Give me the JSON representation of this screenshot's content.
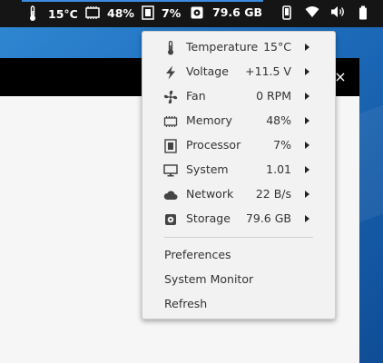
{
  "panel": {
    "temperature": "15°C",
    "memory": "48%",
    "processor": "7%",
    "storage": "79.6 GB"
  },
  "window": {
    "close_glyph": "×"
  },
  "menu": {
    "sensors": [
      {
        "label": "Temperature",
        "value": "15°C",
        "icon": "thermometer-icon"
      },
      {
        "label": "Voltage",
        "value": "+11.5 V",
        "icon": "bolt-icon"
      },
      {
        "label": "Fan",
        "value": "0 RPM",
        "icon": "fan-icon"
      },
      {
        "label": "Memory",
        "value": "48%",
        "icon": "memory-icon"
      },
      {
        "label": "Processor",
        "value": "7%",
        "icon": "processor-icon"
      },
      {
        "label": "System",
        "value": "1.01",
        "icon": "monitor-icon"
      },
      {
        "label": "Network",
        "value": "22 B/s",
        "icon": "cloud-icon"
      },
      {
        "label": "Storage",
        "value": "79.6 GB",
        "icon": "disk-icon"
      }
    ],
    "preferences": "Preferences",
    "system_monitor": "System Monitor",
    "refresh": "Refresh"
  }
}
